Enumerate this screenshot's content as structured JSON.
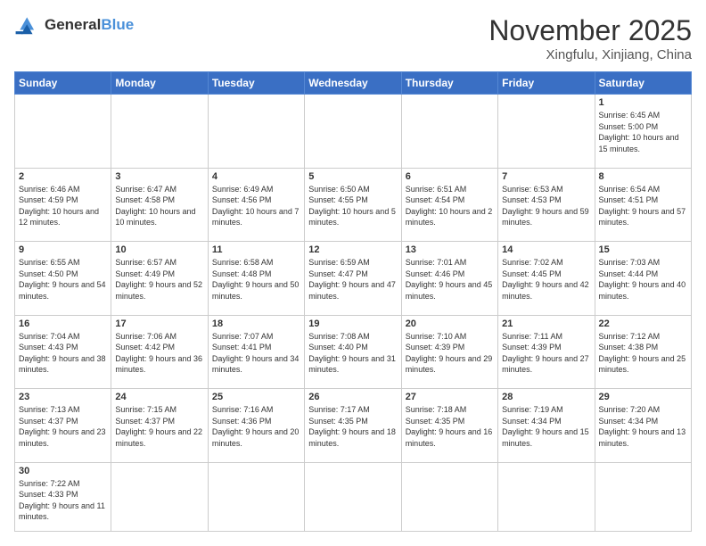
{
  "header": {
    "logo_general": "General",
    "logo_blue": "Blue",
    "title": "November 2025",
    "subtitle": "Xingfulu, Xinjiang, China"
  },
  "weekdays": [
    "Sunday",
    "Monday",
    "Tuesday",
    "Wednesday",
    "Thursday",
    "Friday",
    "Saturday"
  ],
  "weeks": [
    [
      {
        "day": "",
        "info": ""
      },
      {
        "day": "",
        "info": ""
      },
      {
        "day": "",
        "info": ""
      },
      {
        "day": "",
        "info": ""
      },
      {
        "day": "",
        "info": ""
      },
      {
        "day": "",
        "info": ""
      },
      {
        "day": "1",
        "info": "Sunrise: 6:45 AM\nSunset: 5:00 PM\nDaylight: 10 hours and 15 minutes."
      }
    ],
    [
      {
        "day": "2",
        "info": "Sunrise: 6:46 AM\nSunset: 4:59 PM\nDaylight: 10 hours and 12 minutes."
      },
      {
        "day": "3",
        "info": "Sunrise: 6:47 AM\nSunset: 4:58 PM\nDaylight: 10 hours and 10 minutes."
      },
      {
        "day": "4",
        "info": "Sunrise: 6:49 AM\nSunset: 4:56 PM\nDaylight: 10 hours and 7 minutes."
      },
      {
        "day": "5",
        "info": "Sunrise: 6:50 AM\nSunset: 4:55 PM\nDaylight: 10 hours and 5 minutes."
      },
      {
        "day": "6",
        "info": "Sunrise: 6:51 AM\nSunset: 4:54 PM\nDaylight: 10 hours and 2 minutes."
      },
      {
        "day": "7",
        "info": "Sunrise: 6:53 AM\nSunset: 4:53 PM\nDaylight: 9 hours and 59 minutes."
      },
      {
        "day": "8",
        "info": "Sunrise: 6:54 AM\nSunset: 4:51 PM\nDaylight: 9 hours and 57 minutes."
      }
    ],
    [
      {
        "day": "9",
        "info": "Sunrise: 6:55 AM\nSunset: 4:50 PM\nDaylight: 9 hours and 54 minutes."
      },
      {
        "day": "10",
        "info": "Sunrise: 6:57 AM\nSunset: 4:49 PM\nDaylight: 9 hours and 52 minutes."
      },
      {
        "day": "11",
        "info": "Sunrise: 6:58 AM\nSunset: 4:48 PM\nDaylight: 9 hours and 50 minutes."
      },
      {
        "day": "12",
        "info": "Sunrise: 6:59 AM\nSunset: 4:47 PM\nDaylight: 9 hours and 47 minutes."
      },
      {
        "day": "13",
        "info": "Sunrise: 7:01 AM\nSunset: 4:46 PM\nDaylight: 9 hours and 45 minutes."
      },
      {
        "day": "14",
        "info": "Sunrise: 7:02 AM\nSunset: 4:45 PM\nDaylight: 9 hours and 42 minutes."
      },
      {
        "day": "15",
        "info": "Sunrise: 7:03 AM\nSunset: 4:44 PM\nDaylight: 9 hours and 40 minutes."
      }
    ],
    [
      {
        "day": "16",
        "info": "Sunrise: 7:04 AM\nSunset: 4:43 PM\nDaylight: 9 hours and 38 minutes."
      },
      {
        "day": "17",
        "info": "Sunrise: 7:06 AM\nSunset: 4:42 PM\nDaylight: 9 hours and 36 minutes."
      },
      {
        "day": "18",
        "info": "Sunrise: 7:07 AM\nSunset: 4:41 PM\nDaylight: 9 hours and 34 minutes."
      },
      {
        "day": "19",
        "info": "Sunrise: 7:08 AM\nSunset: 4:40 PM\nDaylight: 9 hours and 31 minutes."
      },
      {
        "day": "20",
        "info": "Sunrise: 7:10 AM\nSunset: 4:39 PM\nDaylight: 9 hours and 29 minutes."
      },
      {
        "day": "21",
        "info": "Sunrise: 7:11 AM\nSunset: 4:39 PM\nDaylight: 9 hours and 27 minutes."
      },
      {
        "day": "22",
        "info": "Sunrise: 7:12 AM\nSunset: 4:38 PM\nDaylight: 9 hours and 25 minutes."
      }
    ],
    [
      {
        "day": "23",
        "info": "Sunrise: 7:13 AM\nSunset: 4:37 PM\nDaylight: 9 hours and 23 minutes."
      },
      {
        "day": "24",
        "info": "Sunrise: 7:15 AM\nSunset: 4:37 PM\nDaylight: 9 hours and 22 minutes."
      },
      {
        "day": "25",
        "info": "Sunrise: 7:16 AM\nSunset: 4:36 PM\nDaylight: 9 hours and 20 minutes."
      },
      {
        "day": "26",
        "info": "Sunrise: 7:17 AM\nSunset: 4:35 PM\nDaylight: 9 hours and 18 minutes."
      },
      {
        "day": "27",
        "info": "Sunrise: 7:18 AM\nSunset: 4:35 PM\nDaylight: 9 hours and 16 minutes."
      },
      {
        "day": "28",
        "info": "Sunrise: 7:19 AM\nSunset: 4:34 PM\nDaylight: 9 hours and 15 minutes."
      },
      {
        "day": "29",
        "info": "Sunrise: 7:20 AM\nSunset: 4:34 PM\nDaylight: 9 hours and 13 minutes."
      }
    ],
    [
      {
        "day": "30",
        "info": "Sunrise: 7:22 AM\nSunset: 4:33 PM\nDaylight: 9 hours and 11 minutes."
      },
      {
        "day": "",
        "info": ""
      },
      {
        "day": "",
        "info": ""
      },
      {
        "day": "",
        "info": ""
      },
      {
        "day": "",
        "info": ""
      },
      {
        "day": "",
        "info": ""
      },
      {
        "day": "",
        "info": ""
      }
    ]
  ]
}
